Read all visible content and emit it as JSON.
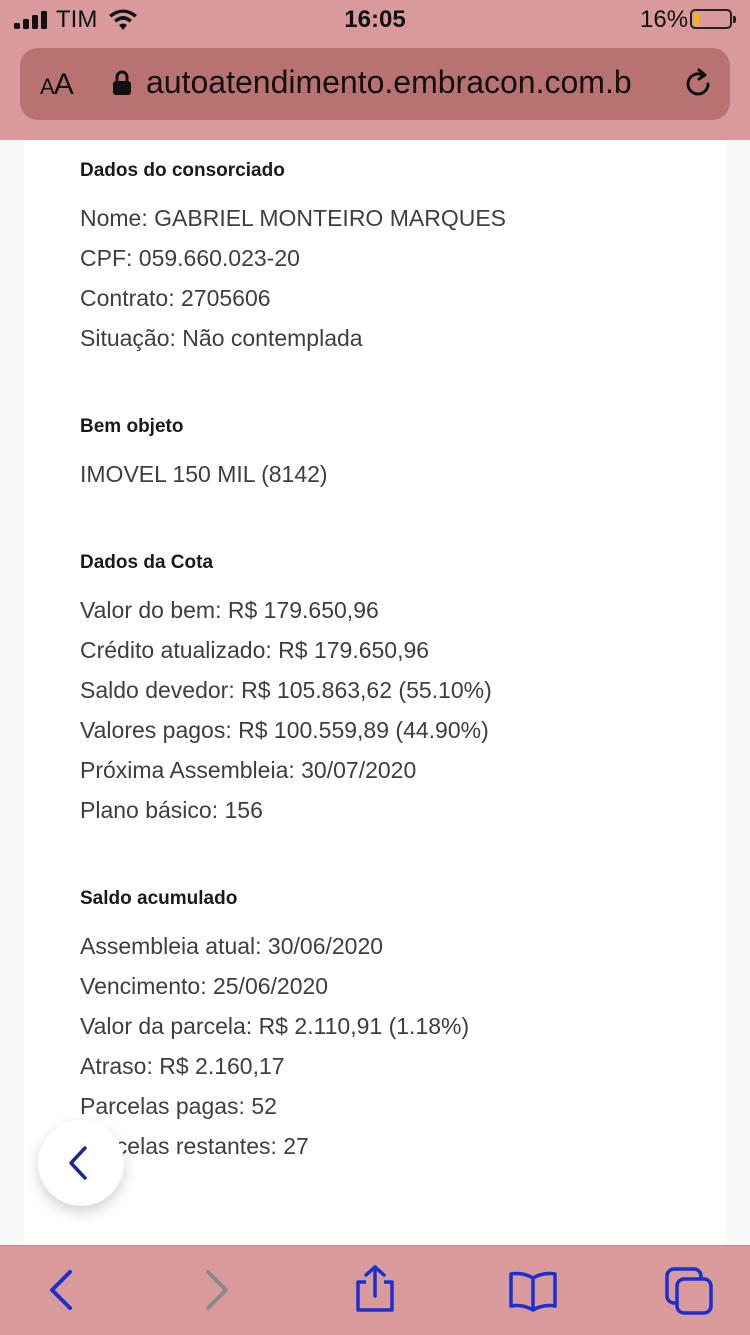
{
  "status_bar": {
    "carrier": "TIM",
    "time": "16:05",
    "battery": "16%",
    "battery_level": 0.16
  },
  "url_bar": {
    "text_size": "AA",
    "url": "autoatendimento.embracon.com.b"
  },
  "sections": {
    "consorciado": {
      "title": "Dados do consorciado",
      "lines": [
        "Nome: GABRIEL MONTEIRO MARQUES",
        "CPF: 059.660.023-20",
        "Contrato: 2705606",
        "Situação: Não contemplada"
      ]
    },
    "bem": {
      "title": "Bem objeto",
      "lines": [
        "IMOVEL 150 MIL (8142)"
      ]
    },
    "cota": {
      "title": "Dados da Cota",
      "lines": [
        "Valor do bem: R$ 179.650,96",
        "Crédito atualizado: R$ 179.650,96",
        "Saldo devedor: R$ 105.863,62 (55.10%)",
        "Valores pagos: R$ 100.559,89 (44.90%)",
        "Próxima Assembleia: 30/07/2020",
        "Plano básico: 156"
      ]
    },
    "saldo": {
      "title": "Saldo acumulado",
      "lines": [
        "Assembleia atual: 30/06/2020",
        "Vencimento: 25/06/2020",
        "Valor da parcela: R$ 2.110,91 (1.18%)",
        "Atraso: R$ 2.160,17",
        "Parcelas pagas: 52",
        "Parcelas restantes: 27"
      ]
    }
  },
  "icons": {
    "fab": "chevron-left-icon",
    "toolbar": [
      "back-icon",
      "forward-icon",
      "share-icon",
      "bookmarks-icon",
      "tabs-icon"
    ]
  },
  "colors": {
    "chrome": "#d89a9a",
    "url_field": "#b87272",
    "toolbar_icon": "#1a2fd1",
    "toolbar_icon_disabled": "#8a8a8a",
    "fab_icon": "#1b2a8a"
  }
}
